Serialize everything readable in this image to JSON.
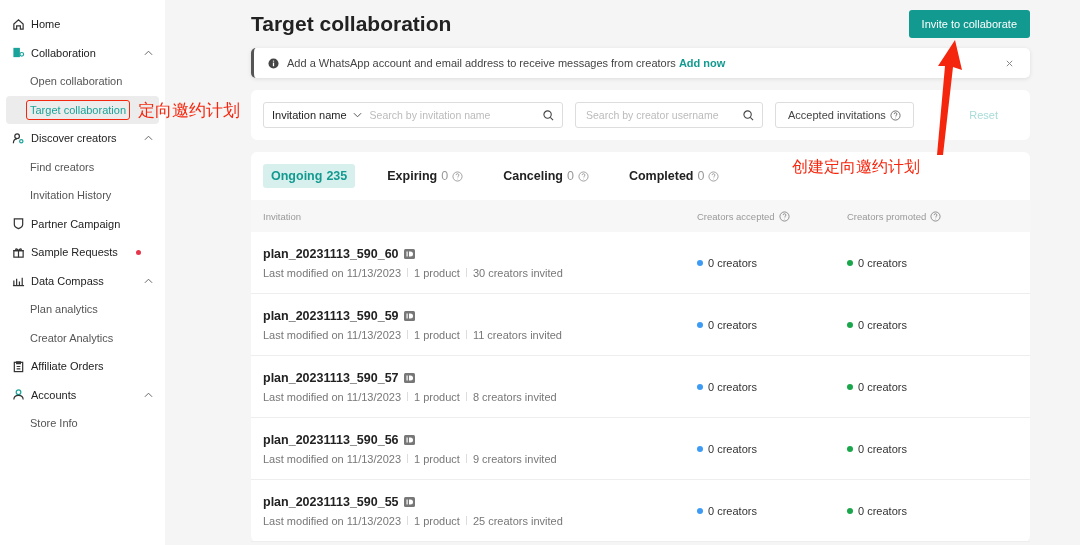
{
  "sidebar": {
    "items": [
      {
        "label": "Home",
        "badge": false
      },
      {
        "label": "Collaboration",
        "expanded": true,
        "badge": false,
        "children": [
          {
            "label": "Open collaboration",
            "selected": false
          },
          {
            "label": "Target collaboration",
            "selected": true
          }
        ]
      },
      {
        "label": "Discover creators",
        "expanded": true,
        "badge": false,
        "children": [
          {
            "label": "Find creators",
            "selected": false
          },
          {
            "label": "Invitation History",
            "selected": false
          }
        ]
      },
      {
        "label": "Partner Campaign",
        "badge": false
      },
      {
        "label": "Sample Requests",
        "badge": true
      },
      {
        "label": "Data Compass",
        "expanded": true,
        "badge": false,
        "children": [
          {
            "label": "Plan analytics",
            "selected": false
          },
          {
            "label": "Creator Analytics",
            "selected": false
          }
        ]
      },
      {
        "label": "Affiliate Orders",
        "badge": false
      },
      {
        "label": "Accounts",
        "expanded": true,
        "badge": false,
        "children": [
          {
            "label": "Store Info",
            "selected": false
          }
        ]
      }
    ]
  },
  "page": {
    "title": "Target collaboration",
    "primary_button": "Invite to collaborate"
  },
  "notice": {
    "text": "Add a WhatsApp account and email address to receive messages from creators",
    "link": "Add now"
  },
  "filters": {
    "select": "Invitation name",
    "name_search": {
      "placeholder": "Search by invitation name"
    },
    "creator_search": {
      "placeholder": "Search by creator username"
    },
    "accepted_button": "Accepted invitations",
    "reset": "Reset"
  },
  "tabs": [
    {
      "label": "Ongoing",
      "count": "235",
      "selected": true,
      "info": false
    },
    {
      "label": "Expiring",
      "count": "0",
      "selected": false,
      "info": true
    },
    {
      "label": "Canceling",
      "count": "0",
      "selected": false,
      "info": true
    },
    {
      "label": "Completed",
      "count": "0",
      "selected": false,
      "info": true
    }
  ],
  "table": {
    "columns": [
      {
        "label": "Invitation",
        "info": false
      },
      {
        "label": "Creators accepted",
        "info": true
      },
      {
        "label": "Creators promoted",
        "info": true
      }
    ],
    "rows": [
      {
        "name": "plan_20231113_590_60",
        "modified": "Last modified on 11/13/2023",
        "products": "1 product",
        "invited": "30 creators invited",
        "accepted": {
          "text": "0 creators",
          "color": "#3d9bf5"
        },
        "promoted": {
          "text": "0 creators",
          "color": "#1aa64a"
        }
      },
      {
        "name": "plan_20231113_590_59",
        "modified": "Last modified on 11/13/2023",
        "products": "1 product",
        "invited": "11 creators invited",
        "accepted": {
          "text": "0 creators",
          "color": "#3d9bf5"
        },
        "promoted": {
          "text": "0 creators",
          "color": "#1aa64a"
        }
      },
      {
        "name": "plan_20231113_590_57",
        "modified": "Last modified on 11/13/2023",
        "products": "1 product",
        "invited": "8 creators invited",
        "accepted": {
          "text": "0 creators",
          "color": "#3d9bf5"
        },
        "promoted": {
          "text": "0 creators",
          "color": "#1aa64a"
        }
      },
      {
        "name": "plan_20231113_590_56",
        "modified": "Last modified on 11/13/2023",
        "products": "1 product",
        "invited": "9 creators invited",
        "accepted": {
          "text": "0 creators",
          "color": "#3d9bf5"
        },
        "promoted": {
          "text": "0 creators",
          "color": "#1aa64a"
        }
      },
      {
        "name": "plan_20231113_590_55",
        "modified": "Last modified on 11/13/2023",
        "products": "1 product",
        "invited": "25 creators invited",
        "accepted": {
          "text": "0 creators",
          "color": "#3d9bf5"
        },
        "promoted": {
          "text": "0 creators",
          "color": "#1aa64a"
        }
      }
    ]
  },
  "annotations": [
    {
      "text": "定向邀约计划"
    },
    {
      "text": "创建定向邀约计划"
    }
  ]
}
